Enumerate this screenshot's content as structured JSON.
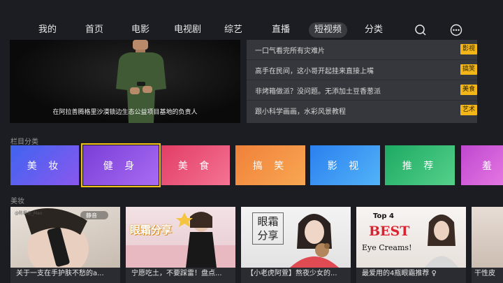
{
  "nav": {
    "items": [
      "我的",
      "首页",
      "电影",
      "电视剧",
      "综艺",
      "直播",
      "短视频",
      "分类"
    ],
    "active": "短视频"
  },
  "hero": {
    "caption": "在阿拉善腾格里沙漠锁边生态公益项目基地的负责人",
    "list": [
      {
        "title": "一口气看完所有灾难片",
        "tag": "影视"
      },
      {
        "title": "高手在民间，这小哥开起挂来直接上嘴",
        "tag": "搞笑"
      },
      {
        "title": "非烤箱做派？没问题。无添加土豆香葱派",
        "tag": "美食"
      },
      {
        "title": "跟小科学画画，水彩风景教程",
        "tag": "艺术"
      }
    ]
  },
  "categories_section": {
    "label": "栏目分类",
    "items": [
      {
        "label": "美 妆",
        "from": "#4a6cf2",
        "to": "#8c55f0"
      },
      {
        "label": "健 身",
        "from": "#7c44e0",
        "to": "#a767f2"
      },
      {
        "label": "美 食",
        "from": "#e8456a",
        "to": "#f36d8c"
      },
      {
        "label": "搞 笑",
        "from": "#f2843b",
        "to": "#f8a14f"
      },
      {
        "label": "影 视",
        "from": "#2f86f0",
        "to": "#4fb0f7"
      },
      {
        "label": "推 荐",
        "from": "#21b06a",
        "to": "#4ccd84"
      },
      {
        "label": "羞",
        "from": "#c34fd2",
        "to": "#e070e0"
      }
    ],
    "focused_index": 1
  },
  "videos_section": {
    "label": "美妆",
    "cards": [
      {
        "title": "关于一支在手护肤不愁的a...",
        "thumb_text": "@陈枫亦_Mao"
      },
      {
        "title": "宁愿吃土，不要踩雷！盘点...",
        "thumb_text": "眼霜分享"
      },
      {
        "title": "【小老虎阿萱】熬夜少女的...",
        "thumb_text": "眼霜 分享"
      },
      {
        "title": "最爱用的4瓶眼霜推荐 ♀",
        "thumb_text_1": "Top 4",
        "thumb_text_2": "BEST",
        "thumb_text_3": "Eye Creams!"
      },
      {
        "title": "干性皮"
      }
    ]
  },
  "colors": {
    "background": "#1c1d22",
    "accent": "#f3c21a"
  }
}
